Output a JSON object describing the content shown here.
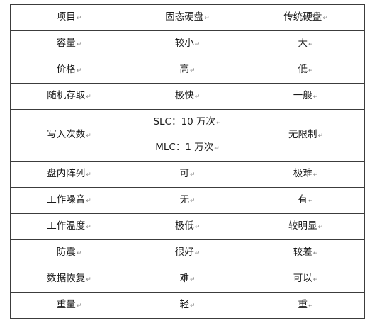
{
  "paragraph_mark": "↵",
  "table": {
    "header": [
      "项目",
      "固态硬盘",
      "传统硬盘"
    ],
    "rows": [
      [
        "容量",
        "较小",
        "大"
      ],
      [
        "价格",
        "高",
        "低"
      ],
      [
        "随机存取",
        "极快",
        "一般"
      ],
      [
        "写入次数",
        [
          "SLC：10 万次",
          "MLC：1 万次"
        ],
        "无限制"
      ],
      [
        "盘内阵列",
        "可",
        "极难"
      ],
      [
        "工作噪音",
        "无",
        "有"
      ],
      [
        "工作温度",
        "极低",
        "较明显"
      ],
      [
        "防震",
        "很好",
        "较差"
      ],
      [
        "数据恢复",
        "难",
        "可以"
      ],
      [
        "重量",
        "轻",
        "重"
      ]
    ]
  }
}
